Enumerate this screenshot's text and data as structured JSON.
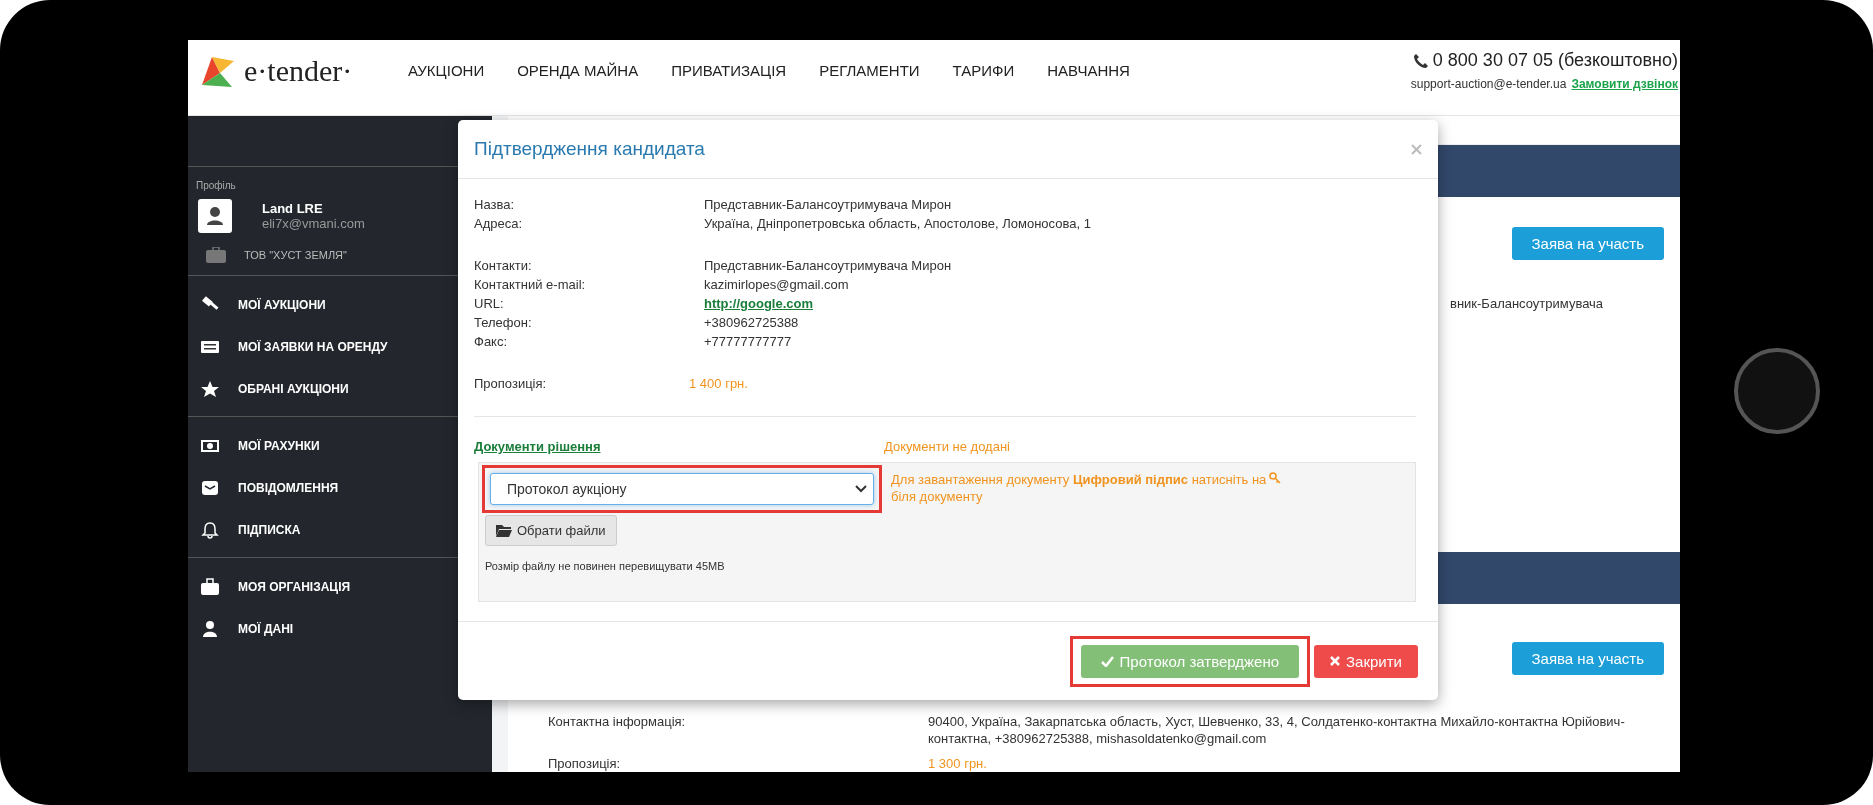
{
  "header": {
    "logo_text": "e·tender·",
    "nav": [
      "АУКЦІОНИ",
      "ОРЕНДА МАЙНА",
      "ПРИВАТИЗАЦІЯ",
      "РЕГЛАМЕНТИ",
      "ТАРИФИ",
      "НАВЧАННЯ"
    ],
    "phone": "0 800 30 07 05 (безкоштовно)",
    "email": "support-auction@e-tender.ua",
    "callback_link": "Замовити дзвінок"
  },
  "sidebar": {
    "profile_label": "Профіль",
    "user_name": "Land LRE",
    "user_email": "eli7x@vmani.com",
    "organization": "ТОВ \"ХУСТ ЗЕМЛЯ\"",
    "groups": [
      [
        "МОЇ АУКЦІОНИ",
        "МОЇ ЗАЯВКИ НА ОРЕНДУ",
        "ОБРАНІ АУКЦІОНИ"
      ],
      [
        "МОЇ РАХУНКИ",
        "ПОВІДОМЛЕННЯ",
        "ПІДПИСКА"
      ],
      [
        "МОЯ ОРГАНІЗАЦІЯ",
        "МОЇ ДАНІ"
      ]
    ]
  },
  "background": {
    "apply_buttons": [
      "Заява на участь",
      "Заява на участь"
    ],
    "partial_text": "вник-Балансоутримувача",
    "contact_label": "Контактна інформація:",
    "contact_value": "90400, Україна, Закарпатська область, Хуст, Шевченко, 33, 4, Солдатенко-контактна Михайло-контактна Юрійович-контактна, +380962725388, mishasoldatenko@gmail.com",
    "offer_label": "Пропозиція:",
    "offer_value": "1 300 грн."
  },
  "modal": {
    "title": "Підтвердження кандидата",
    "groups": [
      [
        {
          "label": "Назва:",
          "value": "Представник-Балансоутримувача Мирон",
          "kind": "text"
        },
        {
          "label": "Адреса:",
          "value": "Україна, Дніпропетровська область, Апостолове, Ломоносова, 1",
          "kind": "text"
        }
      ],
      [
        {
          "label": "Контакти:",
          "value": "Представник-Балансоутримувача Мирон",
          "kind": "text"
        },
        {
          "label": "Контактний e-mail:",
          "value": "kazimirlopes@gmail.com",
          "kind": "text"
        },
        {
          "label": "URL:",
          "value": "http://google.com",
          "kind": "link"
        },
        {
          "label": "Телефон:",
          "value": "+380962725388",
          "kind": "text"
        },
        {
          "label": "Факс:",
          "value": "+77777777777",
          "kind": "text"
        }
      ],
      [
        {
          "label": "Пропозиція:",
          "value": "1 400 грн.",
          "kind": "price"
        }
      ]
    ],
    "documents_heading": "Документи рішення",
    "documents_status": "Документи не додані",
    "document_type": {
      "value": "Протокол аукціону",
      "highlighted": true
    },
    "hint": "Для завантаження документу **Цифровий підпис** натисніть на",
    "hint_tail": "біля документу",
    "choose_files": "Обрати файли",
    "size_note": "Розмір файлу не повинен перевищувати 45MB",
    "confirm_button": {
      "label": "Протокол затверджено",
      "highlighted": true
    },
    "close_button": "Закрити"
  }
}
